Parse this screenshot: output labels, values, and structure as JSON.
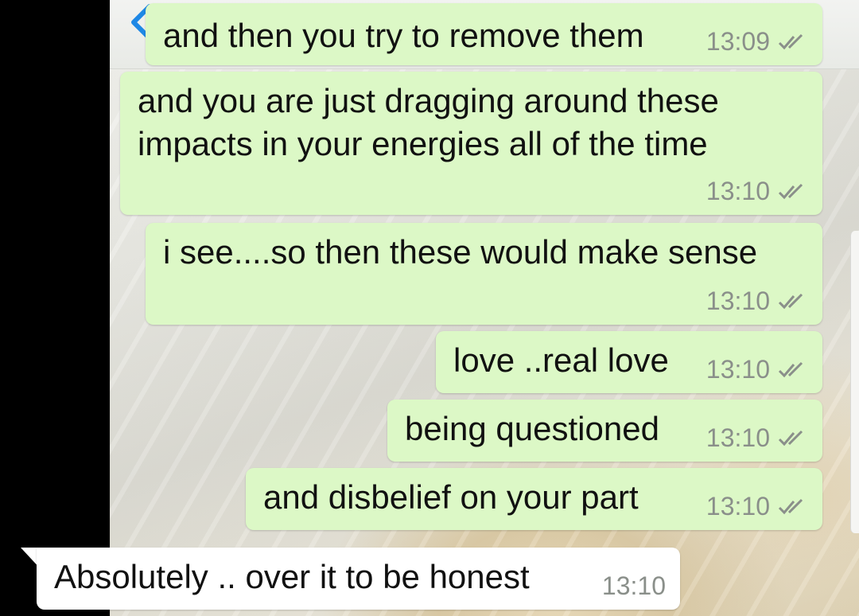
{
  "header": {
    "back_icon": "chevron-left-icon"
  },
  "colors": {
    "outgoing_bubble": "#dcf8c6",
    "incoming_bubble": "#ffffff",
    "back_chevron": "#1e88e5",
    "ticks": "#8a8f8a"
  },
  "messages": [
    {
      "direction": "outgoing",
      "lines": [
        "and then you try to remove them"
      ],
      "time": "13:09",
      "status": "double-check-icon"
    },
    {
      "direction": "outgoing",
      "lines": [
        "and you are just dragging around these",
        "impacts in your energies all of the time"
      ],
      "time": "13:10",
      "status": "double-check-icon"
    },
    {
      "direction": "outgoing",
      "lines": [
        "i see....so then these would make sense"
      ],
      "time": "13:10",
      "status": "double-check-icon"
    },
    {
      "direction": "outgoing",
      "lines": [
        "love ..real love"
      ],
      "time": "13:10",
      "status": "double-check-icon"
    },
    {
      "direction": "outgoing",
      "lines": [
        "being questioned"
      ],
      "time": "13:10",
      "status": "double-check-icon"
    },
    {
      "direction": "outgoing",
      "lines": [
        "and disbelief on  your part"
      ],
      "time": "13:10",
      "status": "double-check-icon"
    },
    {
      "direction": "incoming",
      "lines": [
        "Absolutely .. over it to be honest"
      ],
      "time": "13:10"
    }
  ]
}
